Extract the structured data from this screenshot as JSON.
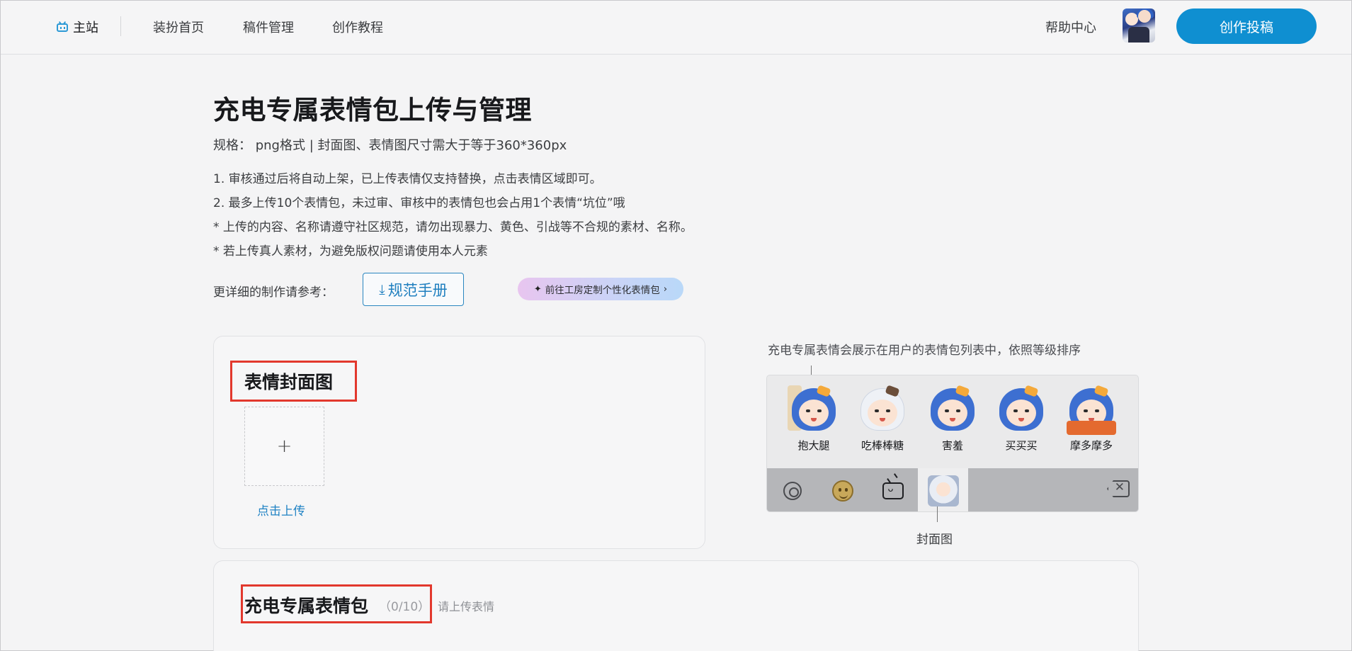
{
  "header": {
    "home_label": "主站",
    "nav": [
      "装扮首页",
      "稿件管理",
      "创作教程"
    ],
    "help_label": "帮助中心",
    "publish_label": "创作投稿"
  },
  "main": {
    "title": "充电专属表情包上传与管理",
    "spec": "规格：  png格式 | 封面图、表情图尺寸需大于等于360*360px",
    "rules": [
      "1. 审核通过后将自动上架，已上传表情仅支持替换，点击表情区域即可。",
      "2. 最多上传10个表情包，未过审、审核中的表情包也会占用1个表情“坑位”哦",
      "* 上传的内容、名称请遵守社区规范，请勿出现暴力、黄色、引战等不合规的素材、名称。",
      "* 若上传真人素材，为避免版权问题请使用本人元素"
    ],
    "reference_label": "更详细的制作请参考：",
    "manual_button": "规范手册",
    "workshop_link": "前往工房定制个性化表情包"
  },
  "cover_section": {
    "title": "表情封面图",
    "upload_plus": "+",
    "upload_link": "点击上传"
  },
  "preview": {
    "caption": "充电专属表情会展示在用户的表情包列表中，依照等级排序",
    "stickers": [
      "抱大腿",
      "吃棒棒糖",
      "害羞",
      "买买买",
      "摩多摩多"
    ],
    "cover_label": "封面图",
    "icons": [
      "gear-icon",
      "emoji-face-icon",
      "bilibili-tv-icon",
      "cover-thumbnail",
      "backspace-icon"
    ]
  },
  "pack_section": {
    "title": "充电专属表情包",
    "count": "（0/10）",
    "hint": "请上传表情"
  },
  "colors": {
    "accent": "#0f8fd1",
    "highlight_box": "#e2382d",
    "link": "#1f82c4"
  }
}
